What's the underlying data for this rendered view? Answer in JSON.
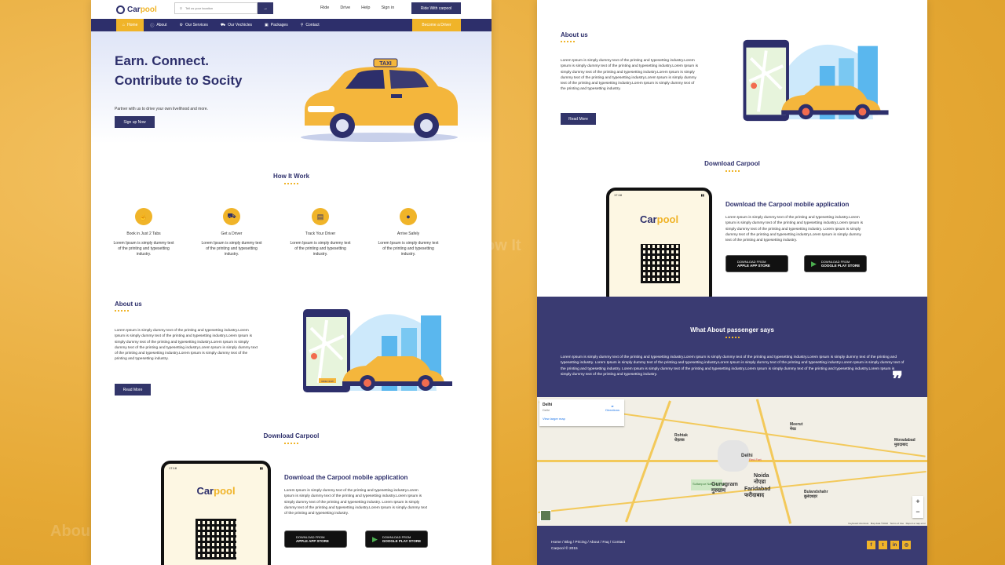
{
  "header": {
    "logo": "Carpool",
    "search_placeholder": "Tell us your location",
    "search_arrow": "→",
    "links": [
      "Ride",
      "Drive",
      "Help",
      "Sign in"
    ],
    "ride_button": "Ride With carpool"
  },
  "nav": {
    "items": [
      "Home",
      "About",
      "Our Services",
      "Our Vechicles",
      "Packages",
      "Contact"
    ],
    "become": "Become a Driver"
  },
  "hero": {
    "title": "Earn. Connect. Contribute to Socity",
    "subtitle": "Partner with us to drive your own livelihood and more.",
    "cta": "Sign up Now",
    "taxi_sign": "TAXI"
  },
  "how": {
    "title": "How It Work",
    "items": [
      {
        "title": "Book in Just 2 Tabs",
        "desc": "Lorem Ipsum is simply dummy text of the printing and typesetting industry."
      },
      {
        "title": "Get a Driver",
        "desc": "Lorem Ipsum is simply dummy text of the printing and typesetting industry."
      },
      {
        "title": "Track Your Driver",
        "desc": "Lorem Ipsum is simply dummy text of the printing and typesetting industry."
      },
      {
        "title": "Arrive Safely",
        "desc": "Lorem Ipsum is simply dummy text of the printing and typesetting industry."
      }
    ]
  },
  "about": {
    "title": "About us",
    "text": "Lorem Ipsum is simply dummy text of the printing and typesetting industry.Lorem Ipsum is simply dummy text of the printing and typesetting industry.Lorem Ipsum is simply dummy text of the printing and typesetting industry.Lorem Ipsum is simply dummy text of the printing and typesetting industry.Lorem Ipsum is simply dummy text of the printing and typesetting industry.Lorem Ipsum is simply dummy text of the printing and typesetting industry.",
    "cta": "Read More",
    "map_label": "YOUR LOCATION",
    "ride_label": "RIDE NOW"
  },
  "download": {
    "title": "Download Carpool",
    "heading": "Download the Carpool mobile application",
    "text": "Lorem Ipsum is simply dummy text of the printing and typesetting industry.Lorem Ipsum is simply dummy text of the printing and typesetting industry.Lorem Ipsum is simply dummy text of the printing and typesetting industry. Lorem Ipsum is simply dummy text of the printing and typesetting industry.Lorem Ipsum is simply dummy text of the printing and typesetting industry.",
    "phone_time": "17:18",
    "apple_small": "DOWNLOAD FROM",
    "apple_big": "APPLE APP STORE",
    "google_small": "DOWNLOAD FROM",
    "google_big": "GOOGLE PLAY STORE"
  },
  "testimonial": {
    "title": "What About passenger says",
    "text": "Lorem Ipsum is simply dummy text of the printing and typesetting industry.Lorem Ipsum is simply dummy text of the printing and typesetting industry.Lorem Ipsum is simply dummy text of the printing and typesetting industry. Lorem Ipsum is simply dummy text of the printing and typesetting industry.Lorem Ipsum is simply dummy text of the printing and typesetting industry.Lorem Ipsum is simply dummy text of the printing and typesetting industry. Lorem Ipsum is simply dummy text of the printing and typesetting industry.Lorem Ipsum is simply dummy text of the printing and typesetting industry.Lorem Ipsum is simply dummy text of the printing and typesetting industry.",
    "quote": "❞"
  },
  "map": {
    "place": "Delhi",
    "place_sub": "Delhi",
    "directions": "Directions",
    "larger": "View larger map",
    "cities": [
      {
        "name": "Rohtak\nरोहतक"
      },
      {
        "name": "Meerut\nमेरठ"
      },
      {
        "name": "Noida\nनोएडा"
      },
      {
        "name": "Gurugram\nगुरुग्राम"
      },
      {
        "name": "Faridabad\nफरीदाबाद"
      },
      {
        "name": "Bulandshahr\nबुलंदशहर"
      },
      {
        "name": "Moradabad\nमुरादाबाद"
      },
      {
        "name": "Sultanpur National Park"
      },
      {
        "name": "Red Fort"
      },
      {
        "name": "Delhi"
      }
    ],
    "zoom_in": "+",
    "zoom_out": "−",
    "credits": "Keyboard shortcuts   Map data ©2022   Terms of Use   Report a map error"
  },
  "footer": {
    "links": "Home / Blog / Pricing / About / Faq / Contact",
    "copyright": "Carpool © 2015",
    "social": [
      "f",
      "t",
      "in",
      "◎"
    ]
  },
  "colors": {
    "navy": "#2d2f6b",
    "accent": "#f0b429",
    "testimonial_bg": "#3a3b72"
  }
}
